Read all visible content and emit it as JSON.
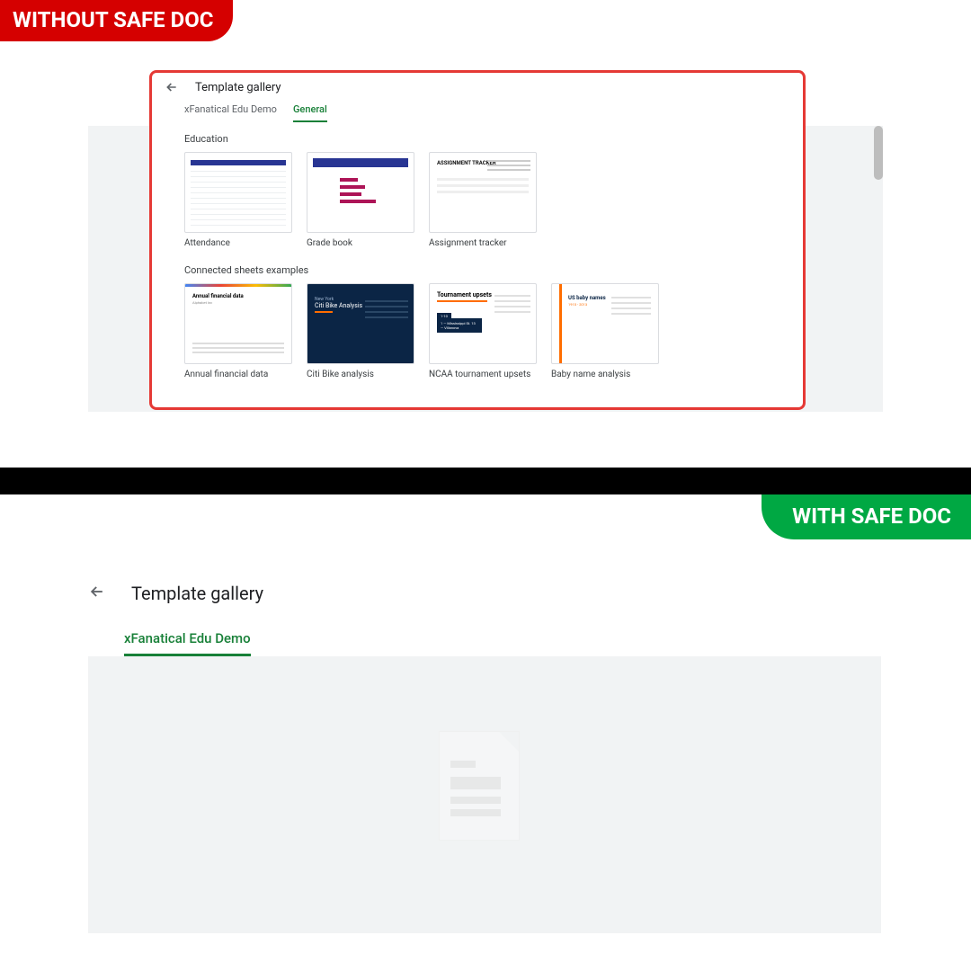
{
  "banners": {
    "without": "WITHOUT SAFE DOC",
    "with": "WITH SAFE DOC"
  },
  "gallery1": {
    "title": "Template gallery",
    "tabs": {
      "org": "xFanatical Edu Demo",
      "general": "General"
    },
    "categories": {
      "education": "Education",
      "connected": "Connected sheets examples"
    },
    "cards": {
      "attendance": "Attendance",
      "gradebook": "Grade book",
      "assignment": "Assignment tracker",
      "financial": "Annual financial data",
      "citi": "Citi Bike analysis",
      "ncaa": "NCAA tournament upsets",
      "baby": "Baby name analysis"
    },
    "thumb_text": {
      "assign_title": "ASSIGNMENT TRACKER",
      "fin_title": "Annual financial data",
      "fin_sub": "Alphabet Inc",
      "citi_sub": "New York",
      "citi_title": "Citi Bike Analysis",
      "ncaa_title": "Tournament upsets",
      "ncaa_chip": "1-10",
      "ncaa_lines": "1 — Mississippi St.\n13 — Villanova",
      "baby_t1": "US baby names",
      "baby_t2": "1910 - 2013"
    }
  },
  "gallery2": {
    "title": "Template gallery",
    "tab": "xFanatical Edu Demo"
  }
}
